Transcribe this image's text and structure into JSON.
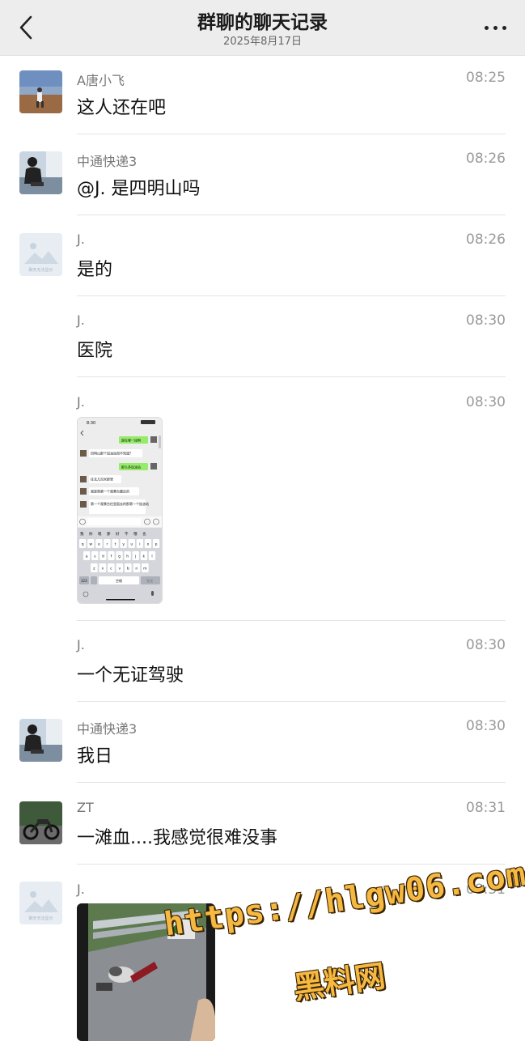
{
  "header": {
    "title": "群聊的聊天记录",
    "date": "2025年8月17日"
  },
  "messages": [
    {
      "name": "A唐小飞",
      "time": "08:25",
      "text": "这人还在吧"
    },
    {
      "name": "中通快递3",
      "time": "08:26",
      "text": "@J. 是四明山吗"
    },
    {
      "name": "J.",
      "time": "08:26",
      "text": "是的"
    },
    {
      "name": "J.",
      "time": "08:30",
      "text": "医院"
    },
    {
      "name": "J.",
      "time": "08:30",
      "image": "chat-screenshot"
    },
    {
      "name": "J.",
      "time": "08:30",
      "text": "一个无证驾驶"
    },
    {
      "name": "中通快递3",
      "time": "08:30",
      "text": "我日"
    },
    {
      "name": "ZT",
      "time": "08:31",
      "text": "一滩血....我感觉很难没事"
    },
    {
      "name": "J.",
      "time": "08:31",
      "image": "road-photo"
    }
  ],
  "avatar_placeholder": "聊天无法显示",
  "screenshot": {
    "status_time": "8:30",
    "bubbles": [
      "是在哪一段啊",
      "四明山那个加油站知不知道?",
      "那么多加油站",
      "往北几百米那里",
      "就是离第一个观景台最近的",
      "第一个观景台往里面去的那第一个加油站"
    ],
    "candidates": [
      "我",
      "你",
      "嗯",
      "那",
      "好",
      "不",
      "哦",
      "也"
    ],
    "keys_row1": [
      "q",
      "w",
      "e",
      "r",
      "t",
      "y",
      "u",
      "i",
      "o",
      "p"
    ],
    "keys_row2": [
      "a",
      "s",
      "d",
      "f",
      "g",
      "h",
      "j",
      "k",
      "l"
    ],
    "keys_row3": [
      "z",
      "x",
      "c",
      "v",
      "b",
      "n",
      "m"
    ],
    "key_123": "123",
    "key_space": "空格",
    "key_send": "发送"
  },
  "watermark": {
    "url": "https://hlgw06.com",
    "site": "黑料网"
  }
}
